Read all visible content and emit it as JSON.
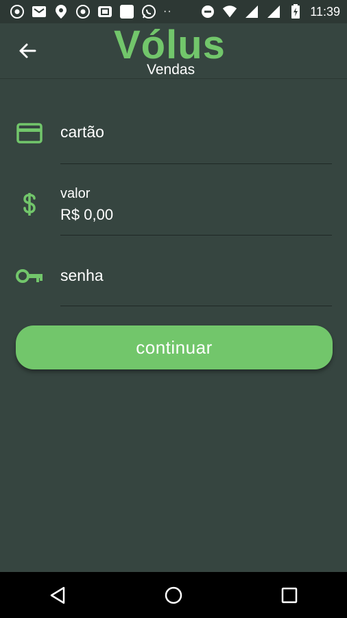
{
  "status_bar": {
    "time": "11:39",
    "overflow_dots": "··",
    "left_icons": [
      "chrome-icon",
      "gmail-icon",
      "maps-pin-icon",
      "chrome-icon",
      "cast-icon",
      "blank-app-icon",
      "whatsapp-icon"
    ],
    "right_icons": [
      "do-not-disturb-icon",
      "wifi-icon",
      "signal-icon",
      "signal-icon",
      "battery-charging-icon"
    ]
  },
  "app_bar": {
    "logo_text": "Vólus",
    "logo_subtitle": "Vendas",
    "back_icon": "arrow-back-icon"
  },
  "form": {
    "card": {
      "icon": "credit-card-icon",
      "placeholder": "cartão"
    },
    "amount": {
      "icon": "dollar-icon",
      "label": "valor",
      "value": "R$ 0,00"
    },
    "password": {
      "icon": "key-icon",
      "placeholder": "senha"
    },
    "submit_label": "continuar"
  },
  "nav_bar": {
    "icons": [
      "nav-back-icon",
      "nav-home-icon",
      "nav-recents-icon"
    ]
  },
  "colors": {
    "background": "#364540",
    "status_bar": "#2d3834",
    "accent": "#72c66b"
  }
}
